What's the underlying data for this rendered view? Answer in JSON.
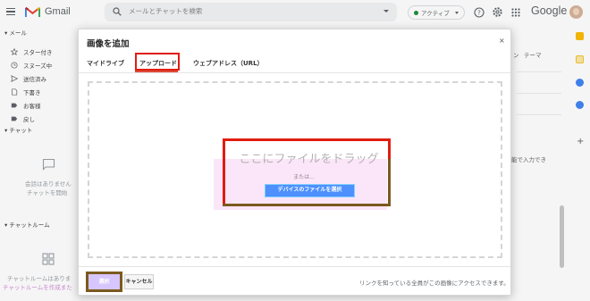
{
  "app": {
    "product_name": "Gmail",
    "brand_name": "Google",
    "search_placeholder": "メールとチャットを検索",
    "status_label": "アクティブ"
  },
  "sidebar": {
    "mail_section": "メール",
    "items": [
      {
        "label": "スター付き",
        "icon": "star-icon"
      },
      {
        "label": "スヌーズ中",
        "icon": "clock-icon"
      },
      {
        "label": "送信済み",
        "icon": "send-icon"
      },
      {
        "label": "下書き",
        "icon": "draft-icon"
      },
      {
        "label": "お客様",
        "icon": "label-icon"
      },
      {
        "label": "戻し",
        "icon": "label-icon"
      }
    ],
    "chat_section": "チャット",
    "chat_empty_line1": "会話はありません",
    "chat_empty_line2": "チャットを開始",
    "rooms_section": "チャットルーム",
    "rooms_empty_line1": "チャットルームはありま",
    "rooms_empty_line2": "チャットルームを作成また"
  },
  "right_panel": {
    "header_partial_1": "ン",
    "header_partial_2": "テーマ",
    "hint_partial": "能で入力でき"
  },
  "dialog": {
    "title": "画像を追加",
    "close": "×",
    "tabs": [
      {
        "label": "マイドライブ",
        "active": false
      },
      {
        "label": "アップロード",
        "active": true
      },
      {
        "label": "ウェブアドレス（URL）",
        "active": false
      }
    ],
    "drop_text": "ここにファイルをドラッグ",
    "or_text": "または...",
    "choose_button": "デバイスのファイルを選択",
    "select_button": "選択",
    "cancel_button": "キャンセル",
    "footer_note": "リンクを知っている全員がこの画像にアクセスできます。"
  },
  "colors": {
    "active_tab_underline": "#dd4b39",
    "choose_button_bg": "#4d90fe",
    "select_button_bg": "#d7c5fd",
    "highlight_red": "#e11d0f",
    "highlight_brown": "#7a5a1e"
  }
}
